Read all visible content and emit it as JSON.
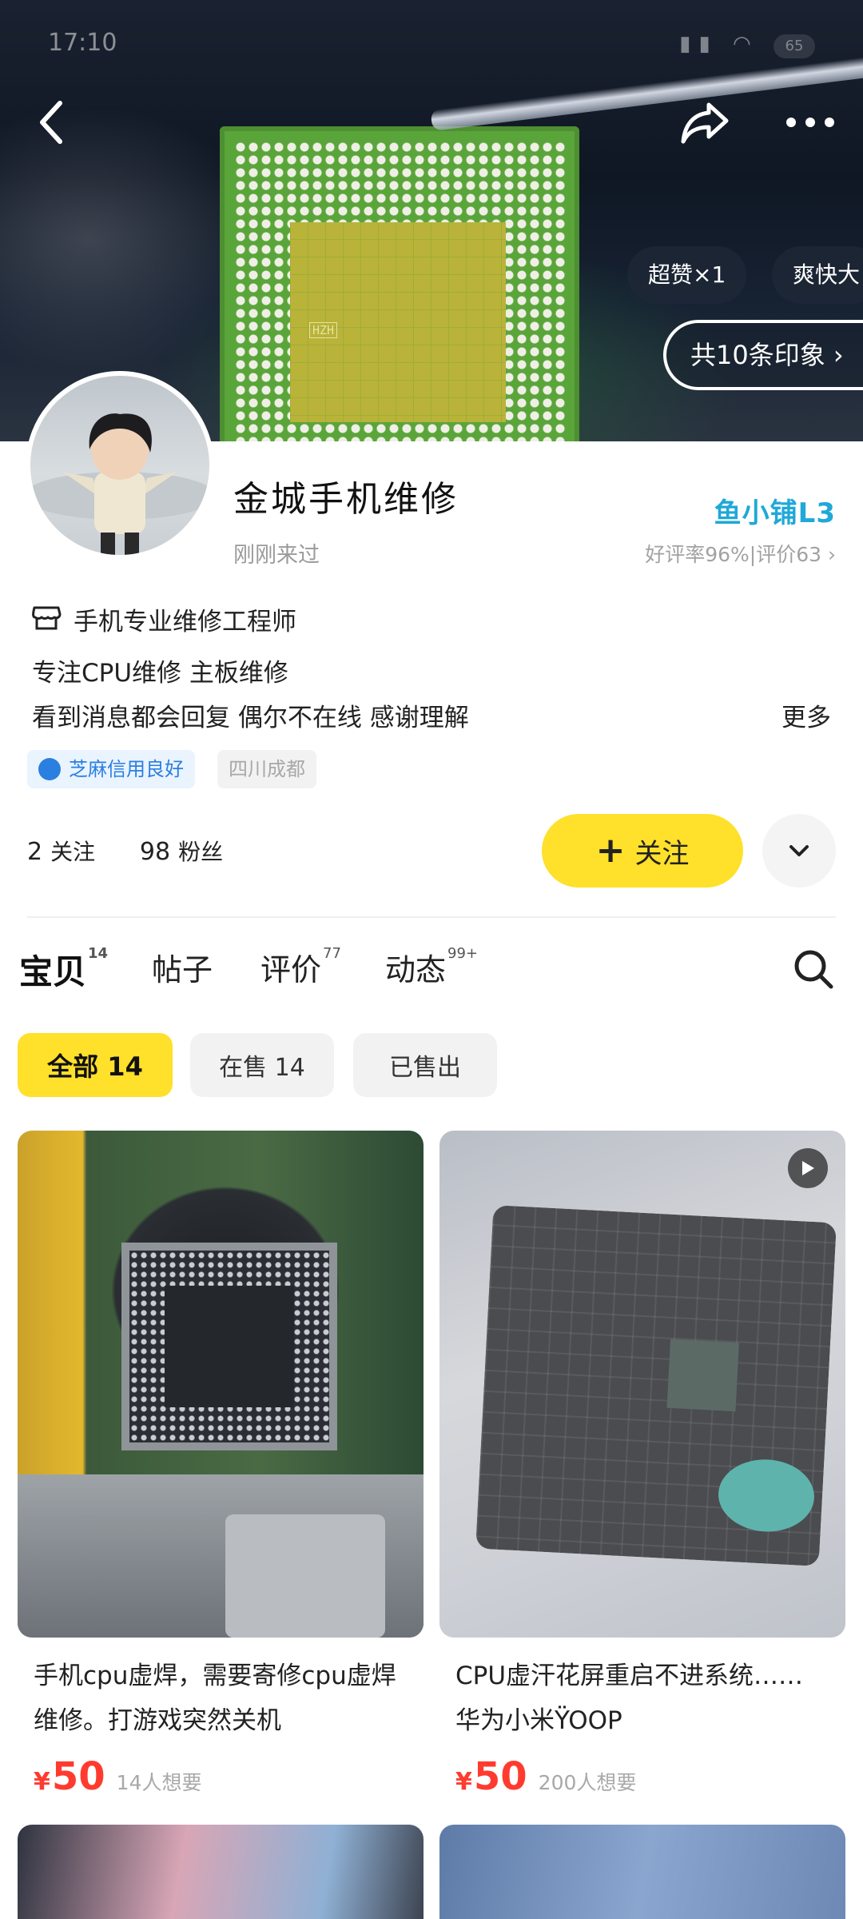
{
  "status_bar": {
    "time": "17:10",
    "battery": "65"
  },
  "header": {
    "impression_tags": [
      "超赞×1",
      "爽快大"
    ],
    "impression_total": "共10条印象"
  },
  "profile": {
    "shop_name": "金城手机维修",
    "last_seen": "刚刚来过",
    "level_badge": "鱼小铺L3",
    "rating_line": "好评率96%|评价63",
    "bio": [
      "手机专业维修工程师",
      "专注CPU维修 主板维修",
      "看到消息都会回复 偶尔不在线 感谢理解"
    ],
    "more_label": "更多",
    "credit_tag": "芝麻信用良好",
    "location_tag": "四川成都",
    "following_count": "2",
    "following_label": "关注",
    "followers_count": "98",
    "followers_label": "粉丝",
    "follow_button": "关注"
  },
  "tabs": [
    {
      "label": "宝贝",
      "count": "14"
    },
    {
      "label": "帖子",
      "count": ""
    },
    {
      "label": "评价",
      "count": "77"
    },
    {
      "label": "动态",
      "count": "99+"
    }
  ],
  "filters": [
    "全部 14",
    "在售 14",
    "已售出"
  ],
  "products": [
    {
      "title": "手机cpu虚焊，需要寄修cpu虚焊维修。打游戏突然关机",
      "price_symbol": "¥",
      "price": "50",
      "wants": "14人想要"
    },
    {
      "title": "CPU虚汗花屏重启不进系统…… 华为小米ŸOOP",
      "price_symbol": "¥",
      "price": "50",
      "wants": "200人想要"
    }
  ],
  "colors": {
    "accent_yellow": "#ffe02a",
    "price_red": "#ff3b30",
    "badge_blue": "#1fa8d8"
  },
  "icons": [
    "back-icon",
    "share-icon",
    "more-dots-icon",
    "store-icon",
    "credit-flame-icon",
    "chevron-down-icon",
    "search-icon",
    "video-play-icon"
  ]
}
